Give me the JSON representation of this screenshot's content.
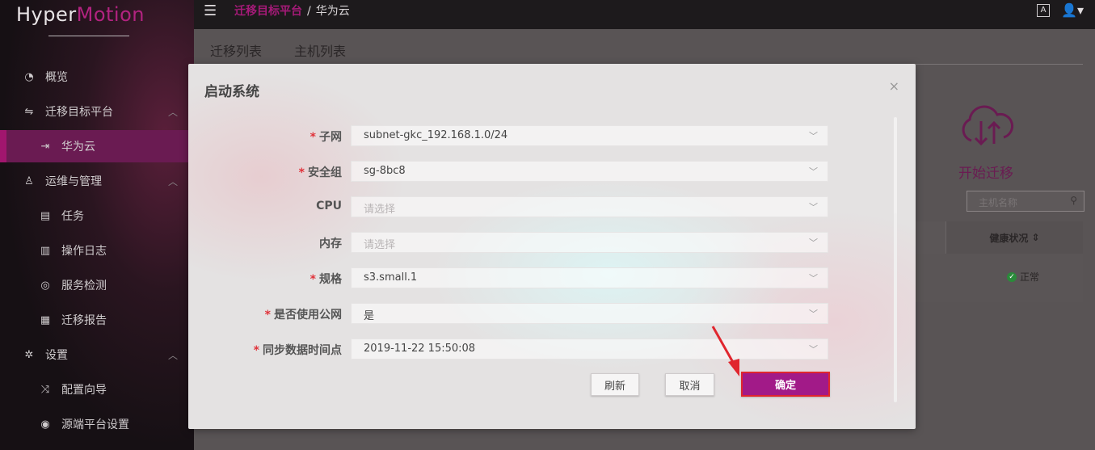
{
  "app": {
    "logo_plain": "Hyper",
    "logo_brand": "Motion"
  },
  "header": {
    "breadcrumb_1": "迁移目标平台",
    "breadcrumb_sep": "/",
    "breadcrumb_2": "华为云",
    "font_icon_text": "A"
  },
  "sidebar": {
    "items": [
      {
        "label": "概览",
        "icon": "dashboard-icon"
      },
      {
        "label": "迁移目标平台",
        "icon": "swap-icon",
        "chevron": "︿"
      },
      {
        "label": "华为云",
        "icon": "login-icon"
      },
      {
        "label": "运维与管理",
        "icon": "user-outline-icon",
        "chevron": "︿"
      },
      {
        "label": "任务",
        "icon": "task-icon"
      },
      {
        "label": "操作日志",
        "icon": "log-icon"
      },
      {
        "label": "服务检测",
        "icon": "monitor-icon"
      },
      {
        "label": "迁移报告",
        "icon": "report-icon"
      },
      {
        "label": "设置",
        "icon": "gear-icon",
        "chevron": "︿"
      },
      {
        "label": "配置向导",
        "icon": "shuffle-icon"
      },
      {
        "label": "源端平台设置",
        "icon": "target-icon"
      }
    ]
  },
  "main": {
    "tabs": [
      "迁移列表",
      "主机列表"
    ],
    "start_migrate": "开始迁移",
    "search_placeholder": "主机名称",
    "column_health": "健康状况",
    "health_value": "正常"
  },
  "modal": {
    "title": "启动系统",
    "close": "×",
    "fields": [
      {
        "label": "子网",
        "required": true,
        "value": "subnet-gkc_192.168.1.0/24"
      },
      {
        "label": "安全组",
        "required": true,
        "value": "sg-8bc8"
      },
      {
        "label": "CPU",
        "required": false,
        "placeholder": "请选择"
      },
      {
        "label": "内存",
        "required": false,
        "placeholder": "请选择"
      },
      {
        "label": "规格",
        "required": true,
        "value": "s3.small.1"
      },
      {
        "label": "是否使用公网",
        "required": true,
        "value": "是"
      },
      {
        "label": "同步数据时间点",
        "required": true,
        "value": "2019-11-22 15:50:08"
      }
    ],
    "buttons": {
      "refresh": "刷新",
      "cancel": "取消",
      "confirm": "确定"
    }
  },
  "colors": {
    "accent": "#a21a88",
    "brand": "#b22380",
    "annotation": "#e0262e"
  }
}
